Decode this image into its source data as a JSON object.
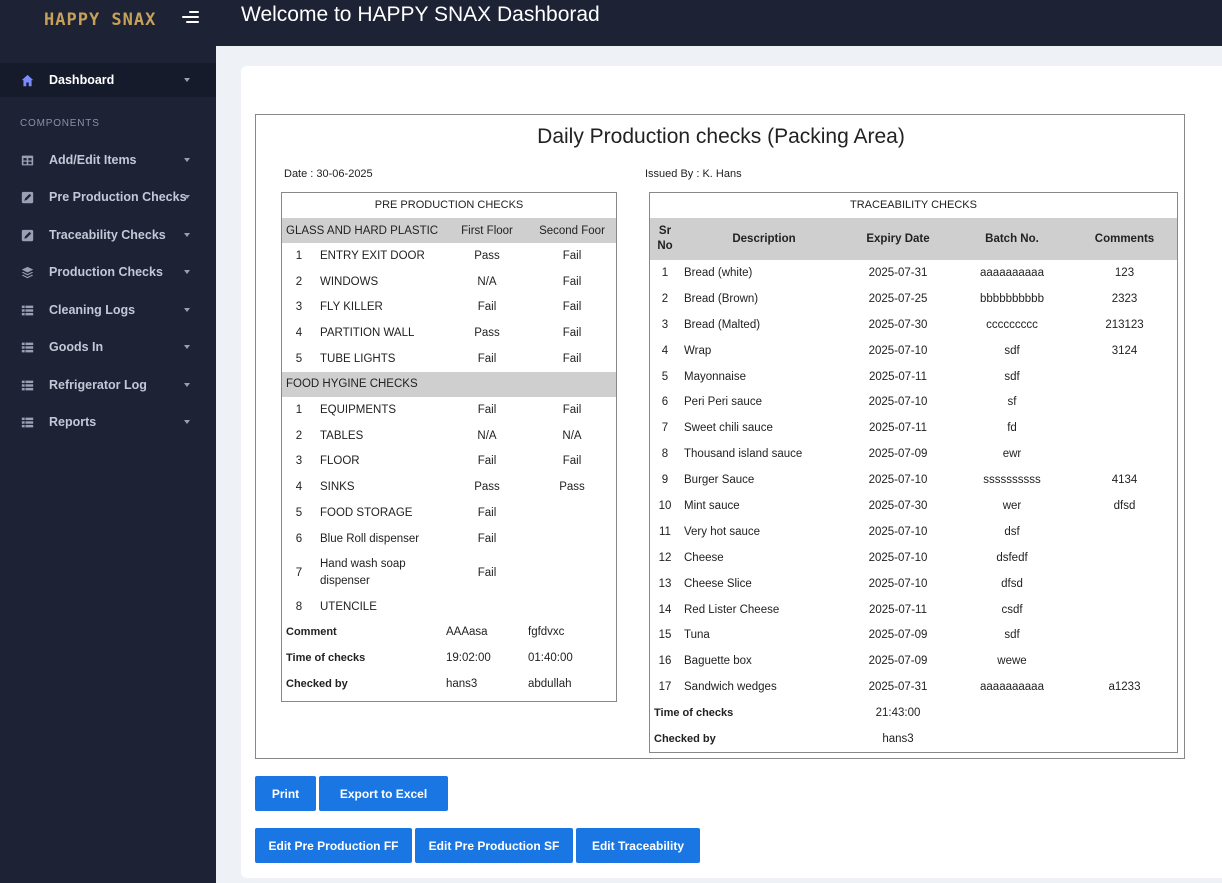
{
  "brand": "HAPPY SNAX",
  "header_title": "Welcome to HAPPY SNAX Dashborad",
  "sidebar": {
    "section_label": "COMPONENTS",
    "items": [
      {
        "label": "Dashboard",
        "icon": "home-icon"
      },
      {
        "label": "Add/Edit Items",
        "icon": "grid-icon"
      },
      {
        "label": "Pre Production Checks",
        "icon": "edit-icon"
      },
      {
        "label": "Traceability Checks",
        "icon": "edit-icon"
      },
      {
        "label": "Production Checks",
        "icon": "layers-icon"
      },
      {
        "label": "Cleaning Logs",
        "icon": "list-icon"
      },
      {
        "label": "Goods In",
        "icon": "list-icon"
      },
      {
        "label": "Refrigerator Log",
        "icon": "list-icon"
      },
      {
        "label": "Reports",
        "icon": "list-icon"
      }
    ]
  },
  "report": {
    "title": "Daily Production checks (Packing Area)",
    "date": "Date : 30-06-2025",
    "issued_by": "Issued By : K. Hans"
  },
  "pre": {
    "title": "PRE PRODUCTION CHECKS",
    "group1": {
      "name": "GLASS AND HARD PLASTIC",
      "col1": "First Floor",
      "col2": "Second Foor"
    },
    "group1_rows": [
      {
        "n": "1",
        "name": "ENTRY EXIT DOOR",
        "ff": "Pass",
        "sf": "Fail"
      },
      {
        "n": "2",
        "name": "WINDOWS",
        "ff": "N/A",
        "sf": "Fail"
      },
      {
        "n": "3",
        "name": "FLY KILLER",
        "ff": "Fail",
        "sf": "Fail"
      },
      {
        "n": "4",
        "name": "PARTITION WALL",
        "ff": "Pass",
        "sf": "Fail"
      },
      {
        "n": "5",
        "name": "TUBE LIGHTS",
        "ff": "Fail",
        "sf": "Fail"
      }
    ],
    "group2": {
      "name": "FOOD HYGINE CHECKS"
    },
    "group2_rows": [
      {
        "n": "1",
        "name": "EQUIPMENTS",
        "ff": "Fail",
        "sf": "Fail"
      },
      {
        "n": "2",
        "name": "TABLES",
        "ff": "N/A",
        "sf": "N/A"
      },
      {
        "n": "3",
        "name": "FLOOR",
        "ff": "Fail",
        "sf": "Fail"
      },
      {
        "n": "4",
        "name": "SINKS",
        "ff": "Pass",
        "sf": "Pass"
      },
      {
        "n": "5",
        "name": "FOOD STORAGE",
        "ff": "Fail",
        "sf": ""
      },
      {
        "n": "6",
        "name": "Blue Roll dispenser",
        "ff": "Fail",
        "sf": ""
      },
      {
        "n": "7",
        "name": "Hand wash soap dispenser",
        "ff": "Fail",
        "sf": ""
      },
      {
        "n": "8",
        "name": "UTENCILE",
        "ff": "",
        "sf": ""
      }
    ],
    "footer": [
      {
        "label": "Comment",
        "ff": "AAAasa",
        "sf": "fgfdvxc"
      },
      {
        "label": "Time of checks",
        "ff": "19:02:00",
        "sf": "01:40:00"
      },
      {
        "label": "Checked by",
        "ff": "hans3",
        "sf": "abdullah"
      }
    ]
  },
  "trace": {
    "title": "TRACEABILITY CHECKS",
    "headers": {
      "sr": "Sr No",
      "desc": "Description",
      "exp": "Expiry Date",
      "batch": "Batch No.",
      "com": "Comments"
    },
    "rows": [
      {
        "sr": "1",
        "desc": "Bread (white)",
        "exp": "2025-07-31",
        "batch": "aaaaaaaaaa",
        "com": "123"
      },
      {
        "sr": "2",
        "desc": "Bread (Brown)",
        "exp": "2025-07-25",
        "batch": "bbbbbbbbbb",
        "com": "2323"
      },
      {
        "sr": "3",
        "desc": "Bread (Malted)",
        "exp": "2025-07-30",
        "batch": "ccccccccc",
        "com": "213123"
      },
      {
        "sr": "4",
        "desc": "Wrap",
        "exp": "2025-07-10",
        "batch": "sdf",
        "com": "3124"
      },
      {
        "sr": "5",
        "desc": "Mayonnaise",
        "exp": "2025-07-11",
        "batch": "sdf",
        "com": ""
      },
      {
        "sr": "6",
        "desc": "Peri Peri sauce",
        "exp": "2025-07-10",
        "batch": "sf",
        "com": ""
      },
      {
        "sr": "7",
        "desc": "Sweet chili sauce",
        "exp": "2025-07-11",
        "batch": "fd",
        "com": ""
      },
      {
        "sr": "8",
        "desc": "Thousand island sauce",
        "exp": "2025-07-09",
        "batch": "ewr",
        "com": ""
      },
      {
        "sr": "9",
        "desc": "Burger Sauce",
        "exp": "2025-07-10",
        "batch": "ssssssssss",
        "com": "4134"
      },
      {
        "sr": "10",
        "desc": "Mint sauce",
        "exp": "2025-07-30",
        "batch": "wer",
        "com": "dfsd"
      },
      {
        "sr": "11",
        "desc": "Very hot sauce",
        "exp": "2025-07-10",
        "batch": "dsf",
        "com": ""
      },
      {
        "sr": "12",
        "desc": "Cheese",
        "exp": "2025-07-10",
        "batch": "dsfedf",
        "com": ""
      },
      {
        "sr": "13",
        "desc": "Cheese Slice",
        "exp": "2025-07-10",
        "batch": "dfsd",
        "com": ""
      },
      {
        "sr": "14",
        "desc": "Red Lister Cheese",
        "exp": "2025-07-11",
        "batch": "csdf",
        "com": ""
      },
      {
        "sr": "15",
        "desc": "Tuna",
        "exp": "2025-07-09",
        "batch": "sdf",
        "com": ""
      },
      {
        "sr": "16",
        "desc": "Baguette box",
        "exp": "2025-07-09",
        "batch": "wewe",
        "com": ""
      },
      {
        "sr": "17",
        "desc": "Sandwich wedges",
        "exp": "2025-07-31",
        "batch": "aaaaaaaaaa",
        "com": "a1233"
      }
    ],
    "footer": [
      {
        "label": "Time of checks",
        "value": "21:43:00"
      },
      {
        "label": "Checked by",
        "value": "hans3"
      }
    ]
  },
  "buttons": {
    "print": "Print",
    "export": "Export to Excel",
    "edit_ff": "Edit Pre Production FF",
    "edit_sf": "Edit Pre Production SF",
    "edit_trace": "Edit Traceability"
  },
  "colors": {
    "sidebar": "#1d2235",
    "button": "#1976e3",
    "group_header": "#cfcfcf",
    "brand": "#c6a15a"
  }
}
